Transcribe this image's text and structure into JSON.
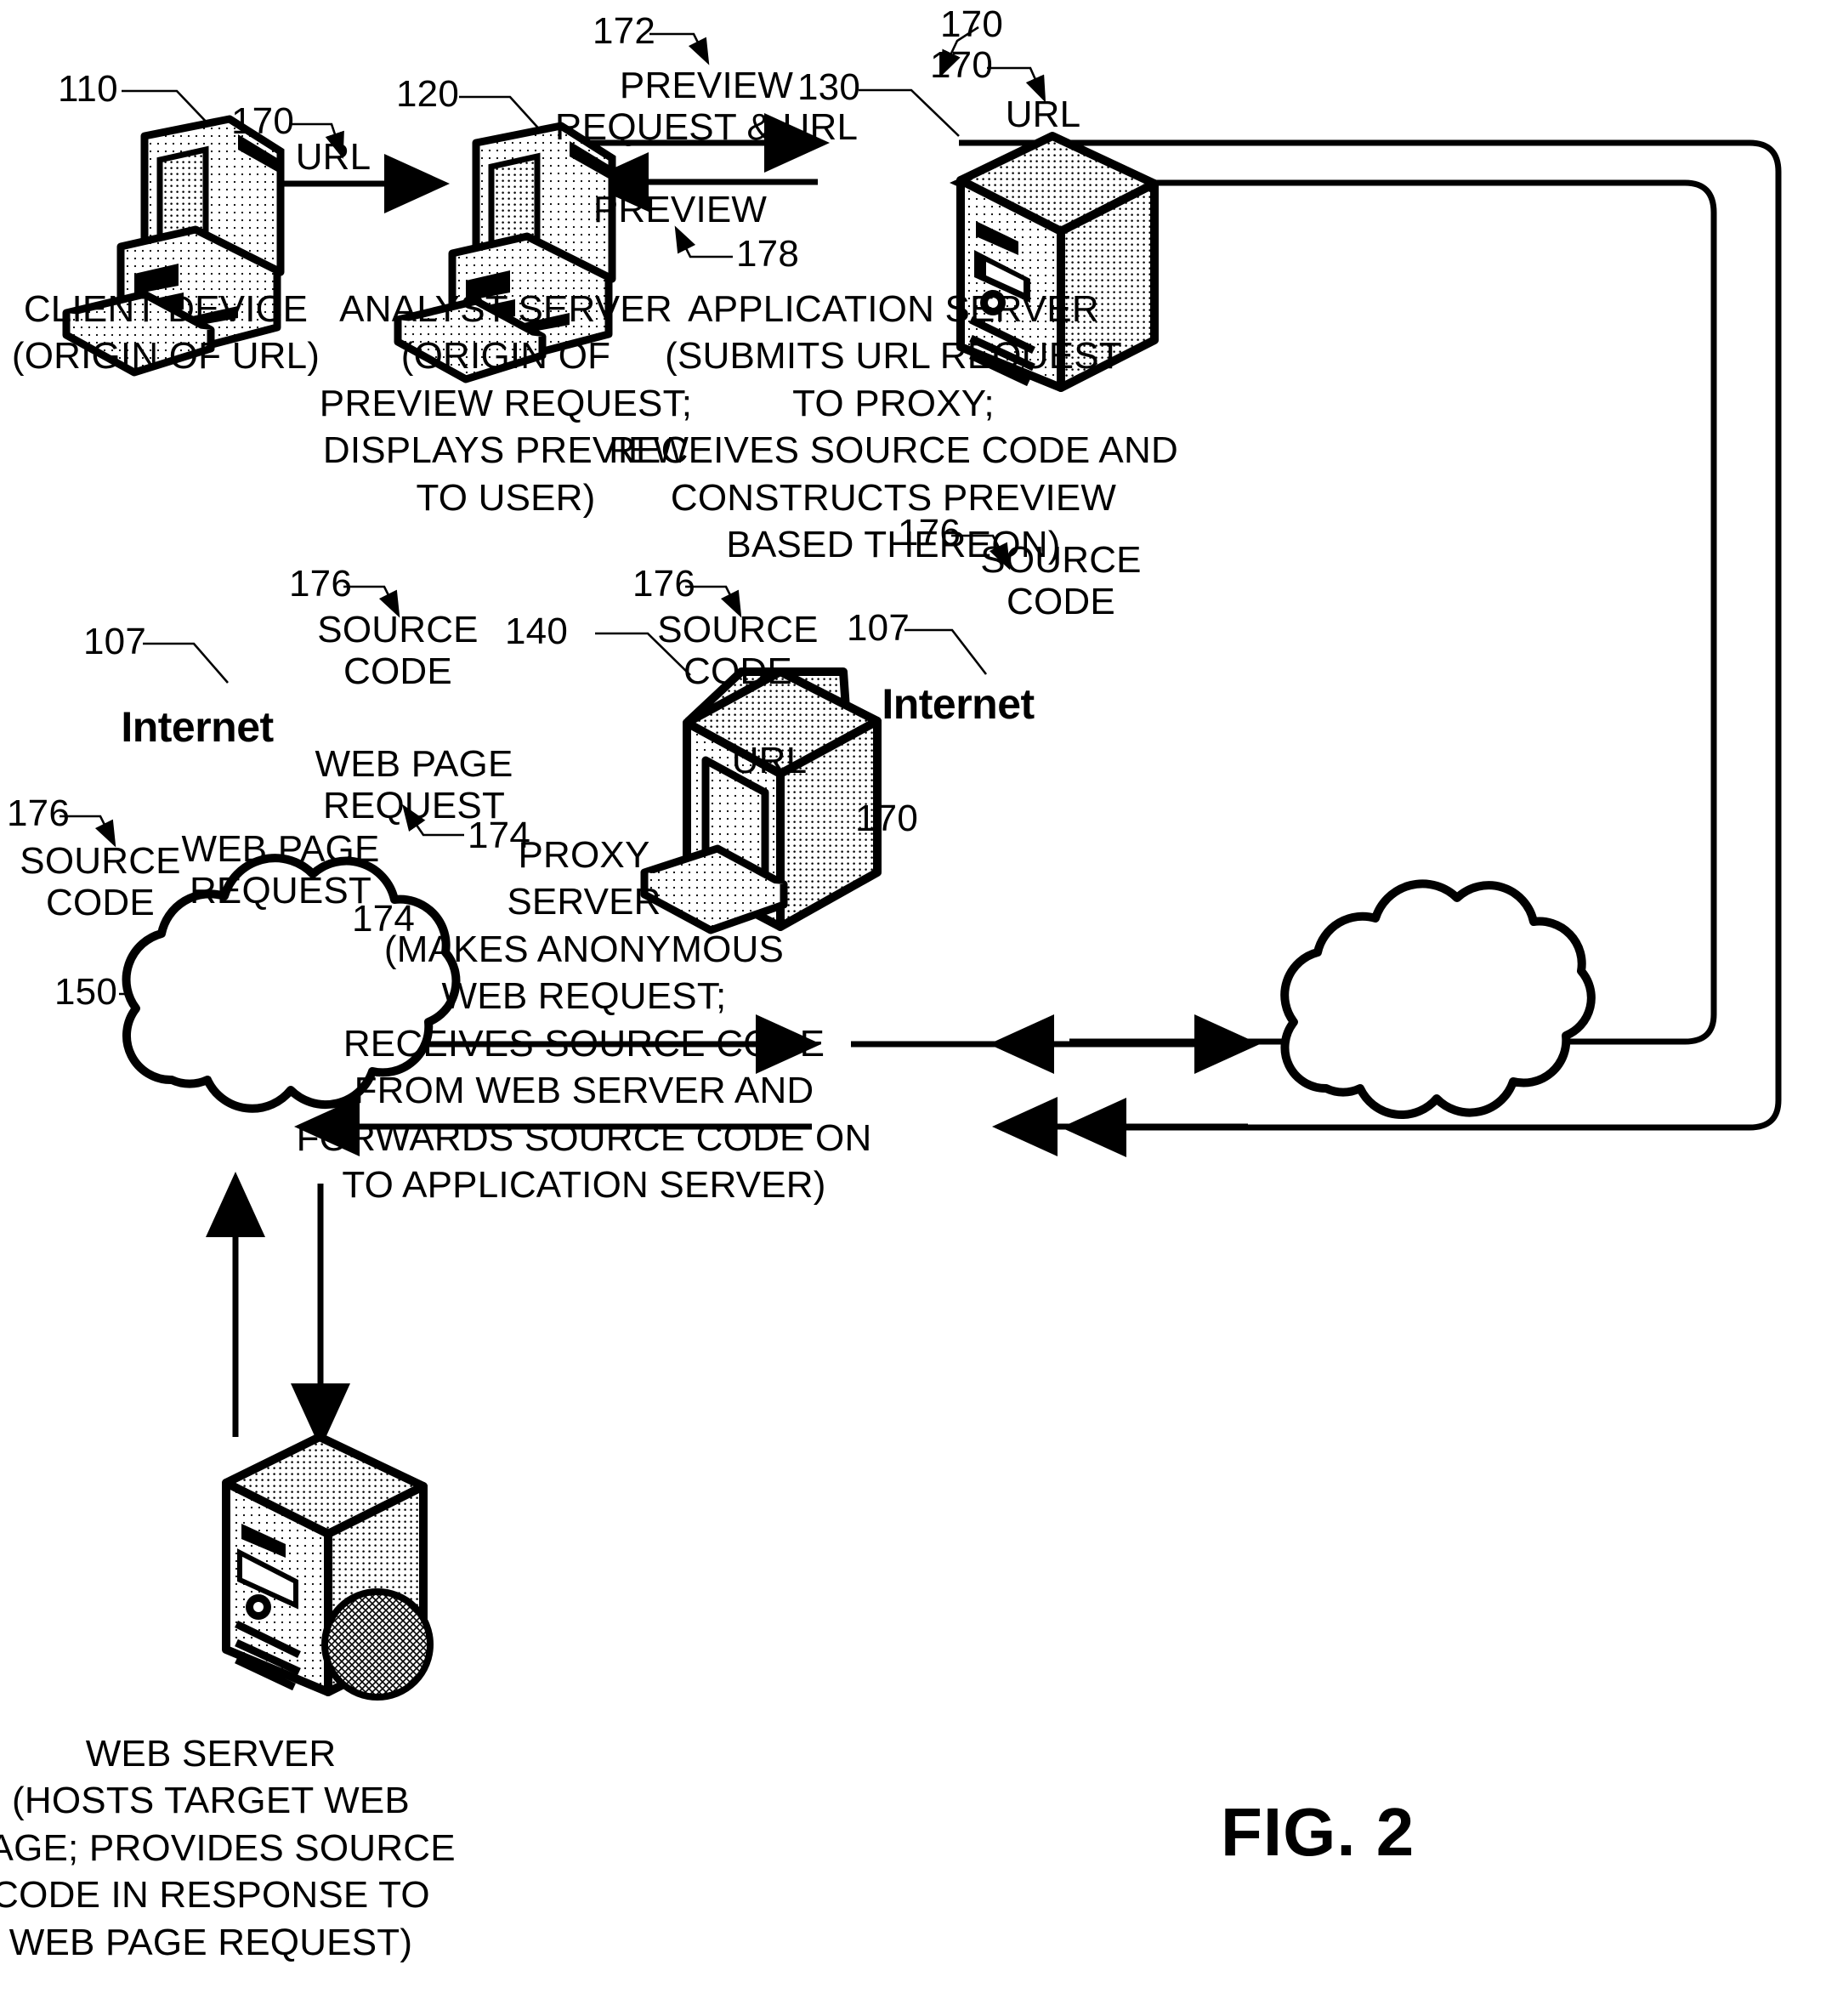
{
  "figure": {
    "title": "FIG. 2",
    "type": "patent-network-diagram"
  },
  "nodes": [
    {
      "ref": "110",
      "icon": "desktop-computer-icon",
      "caption": "CLIENT DEVICE\n(ORIGIN OF URL)"
    },
    {
      "ref": "120",
      "icon": "desktop-computer-icon",
      "caption": "ANALYST SERVER\n(ORIGIN OF\nPREVIEW REQUEST;\nDISPLAYS PREVIEW\nTO USER)"
    },
    {
      "ref": "130",
      "icon": "server-tower-icon",
      "caption": "APPLICATION SERVER\n(SUBMITS URL REQUEST\nTO PROXY;\nRECEIVES SOURCE CODE AND\nCONSTRUCTS PREVIEW\nBASED THEREON)"
    },
    {
      "ref": "140",
      "icon": "monitor-box-icon",
      "caption": "PROXY\nSERVER\n(MAKES ANONYMOUS\nWEB REQUEST;\nRECEIVES SOURCE CODE\nFROM WEB SERVER AND\nFORWARDS SOURCE CODE ON\nTO APPLICATION SERVER)"
    },
    {
      "ref": "150",
      "icon": "server-tower-disc-icon",
      "caption": "WEB SERVER\n(HOSTS TARGET WEB\nPAGE; PROVIDES SOURCE\nCODE IN RESPONSE TO\nWEB PAGE REQUEST)"
    },
    {
      "ref": "107",
      "icon": "cloud-icon",
      "caption": "Internet"
    },
    {
      "ref": "107",
      "icon": "cloud-icon",
      "caption": "Internet"
    }
  ],
  "flows": [
    {
      "ref": "170",
      "label": "URL"
    },
    {
      "ref": "172",
      "label": "PREVIEW\nREQUEST & URL"
    },
    {
      "ref": "170",
      "label": "URL"
    },
    {
      "ref": "178",
      "label": "PREVIEW"
    },
    {
      "ref": "170",
      "label": "URL"
    },
    {
      "ref": "176",
      "label": "SOURCE\nCODE"
    },
    {
      "ref": "176",
      "label": "SOURCE\nCODE"
    },
    {
      "ref": "176",
      "label": "SOURCE\nCODE"
    },
    {
      "ref": "176",
      "label": "SOURCE\nCODE"
    },
    {
      "ref": "170",
      "label": "URL"
    },
    {
      "ref": "174",
      "label": "WEB PAGE\nREQUEST"
    },
    {
      "ref": "174",
      "label": "WEB PAGE\nREQUEST"
    }
  ],
  "labels": {
    "ref_110": "110",
    "ref_120": "120",
    "ref_130": "130",
    "ref_140": "140",
    "ref_150": "150",
    "ref_107_left": "107",
    "ref_107_right": "107",
    "ref_170_a": "170",
    "ref_170_b": "170",
    "ref_170_c": "170",
    "ref_170_d": "170",
    "ref_172": "172",
    "ref_174_a": "174",
    "ref_174_b": "174",
    "ref_176_a": "176",
    "ref_176_b": "176",
    "ref_176_c": "176",
    "ref_176_d": "176",
    "ref_178": "178",
    "url_a": "URL",
    "url_b": "URL",
    "url_c": "URL",
    "preview_request_url": "PREVIEW\nREQUEST & URL",
    "preview": "PREVIEW",
    "source_code_a": "SOURCE\nCODE",
    "source_code_b": "SOURCE\nCODE",
    "source_code_c": "SOURCE\nCODE",
    "source_code_d": "SOURCE\nCODE",
    "web_page_request_a": "WEB PAGE\nREQUEST",
    "web_page_request_b": "WEB PAGE\nREQUEST",
    "internet_left": "Internet",
    "internet_right": "Internet",
    "caption_client": "CLIENT DEVICE\n(ORIGIN OF URL)",
    "caption_analyst": "ANALYST SERVER\n(ORIGIN OF\nPREVIEW REQUEST;\nDISPLAYS PREVIEW\nTO USER)",
    "caption_application": "APPLICATION SERVER\n(SUBMITS URL REQUEST\nTO PROXY;\nRECEIVES SOURCE CODE AND\nCONSTRUCTS PREVIEW\nBASED THEREON)",
    "caption_proxy": "PROXY\nSERVER\n(MAKES ANONYMOUS\nWEB REQUEST;\nRECEIVES SOURCE CODE\nFROM WEB SERVER AND\nFORWARDS SOURCE CODE ON\nTO APPLICATION SERVER)",
    "caption_webserver": "WEB SERVER\n(HOSTS TARGET WEB\nPAGE; PROVIDES SOURCE\nCODE IN RESPONSE TO\nWEB PAGE REQUEST)",
    "fig_title": "FIG. 2"
  },
  "colors": {
    "ink": "#000000",
    "paper": "#ffffff",
    "fill_light": "#f2f2f2",
    "fill_mid": "#d9d9d9",
    "fill_dark": "#bfbfbf"
  }
}
